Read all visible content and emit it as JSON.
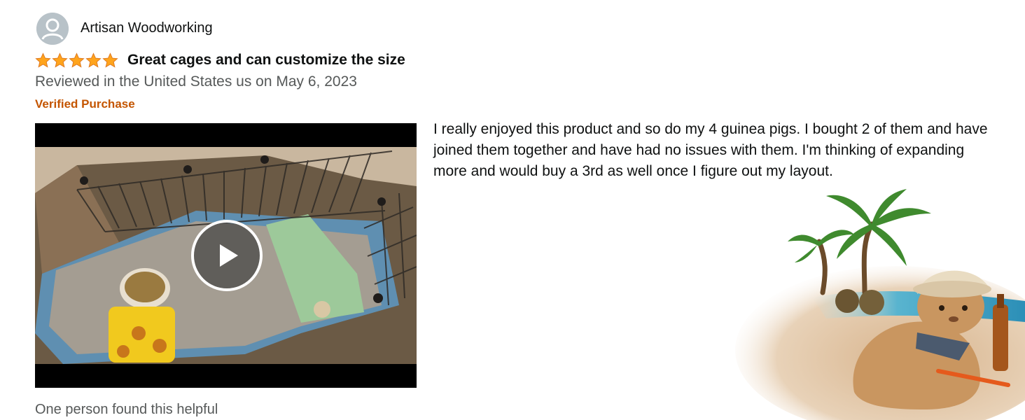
{
  "reviewer": {
    "name": "Artisan Woodworking",
    "avatar_icon": "user-avatar-icon"
  },
  "review": {
    "rating": 5,
    "rating_max": 5,
    "title": "Great cages and can customize the size",
    "date_line": "Reviewed in the United States us on May 6, 2023",
    "verified_label": "Verified Purchase",
    "body": " I really enjoyed this product and so do my 4 guinea pigs. I bought 2 of them and have joined them together and have had no issues with them. I'm thinking of expanding more and would buy a 3rd as well once I figure out my layout.",
    "helpful_text": "One person found this helpful"
  },
  "video": {
    "play_icon": "play-icon"
  },
  "colors": {
    "star": "#ffa41c",
    "verified": "#c45500",
    "muted_text": "#565959",
    "text": "#0f1111"
  }
}
